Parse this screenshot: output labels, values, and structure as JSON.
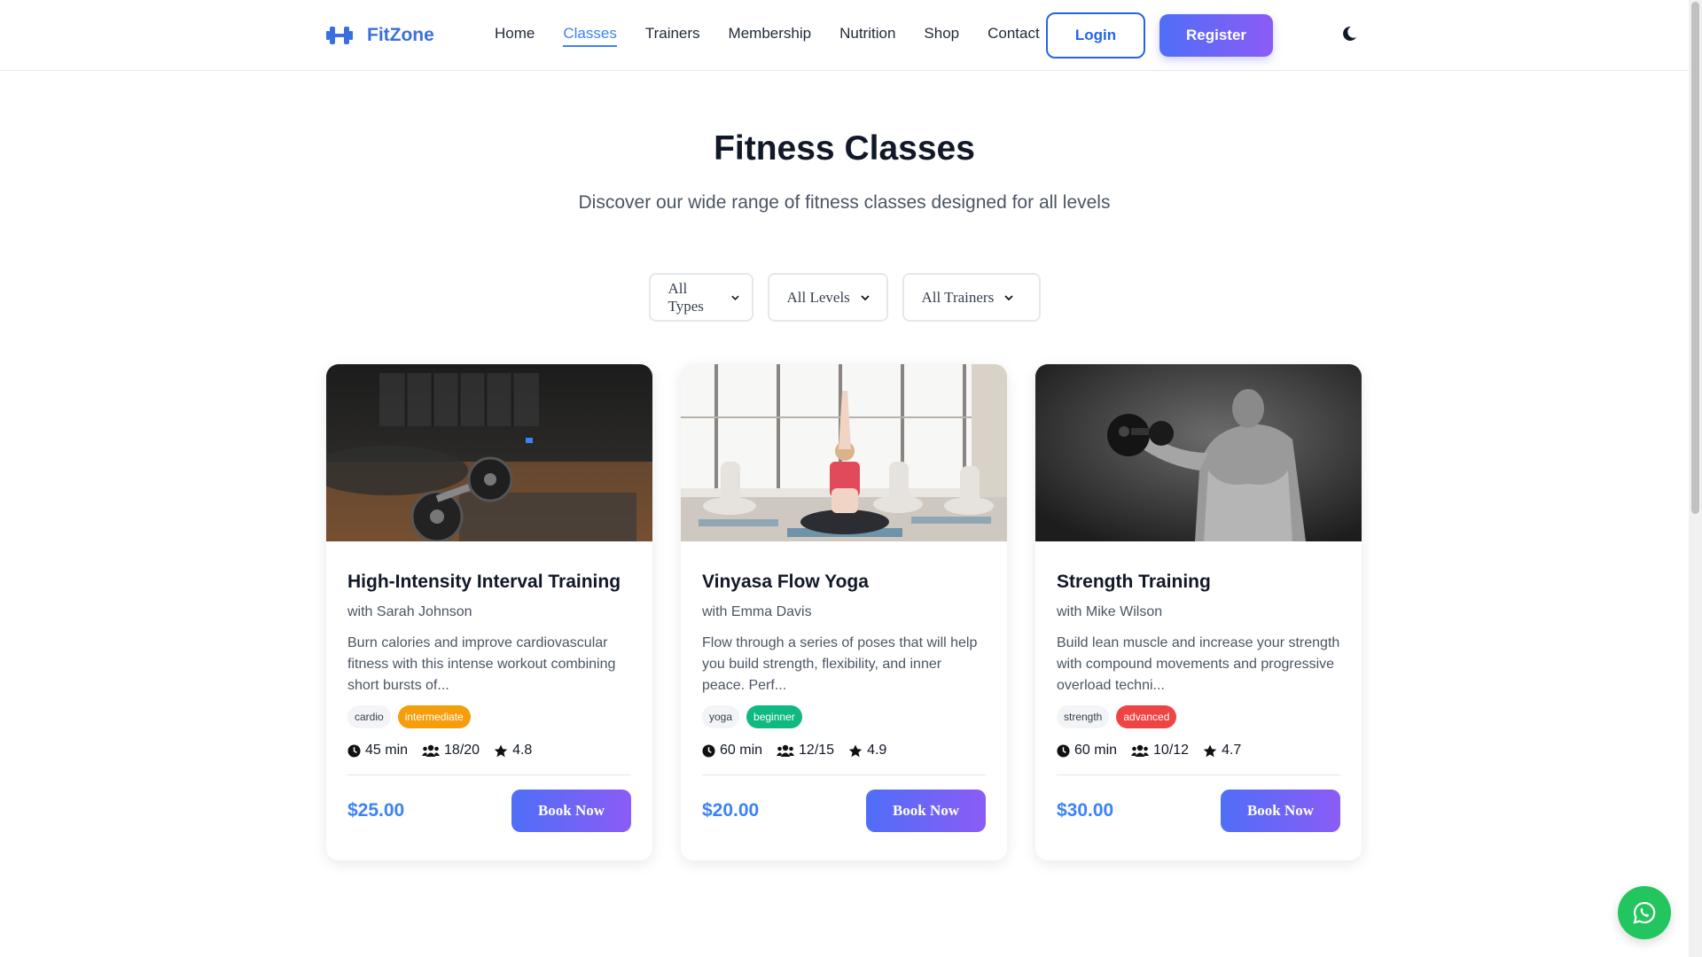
{
  "brand": {
    "name": "FitZone",
    "accent": "#3b6fe0"
  },
  "nav": {
    "items": [
      {
        "label": "Home",
        "active": false
      },
      {
        "label": "Classes",
        "active": true
      },
      {
        "label": "Trainers",
        "active": false
      },
      {
        "label": "Membership",
        "active": false
      },
      {
        "label": "Nutrition",
        "active": false
      },
      {
        "label": "Shop",
        "active": false
      },
      {
        "label": "Contact",
        "active": false
      }
    ],
    "login_label": "Login",
    "register_label": "Register",
    "theme_icon": "moon-icon"
  },
  "hero": {
    "title": "Fitness Classes",
    "subtitle": "Discover our wide range of fitness classes designed for all levels"
  },
  "filters": {
    "type": "All Types",
    "level": "All Levels",
    "trainer": "All Trainers"
  },
  "classes": [
    {
      "title": "High-Intensity Interval Training",
      "trainer": "with Sarah Johnson",
      "description": "Burn calories and improve cardiovascular fitness with this intense workout combining short bursts of...",
      "type_tag": "cardio",
      "level_tag": "intermediate",
      "level_color": "#f59e0b",
      "duration": "45 min",
      "capacity": "18/20",
      "rating": "4.8",
      "price": "$25.00",
      "cta": "Book Now",
      "image": "gym-dumbbell-photo"
    },
    {
      "title": "Vinyasa Flow Yoga",
      "trainer": "with Emma Davis",
      "description": "Flow through a series of poses that will help you build strength, flexibility, and inner peace. Perf...",
      "type_tag": "yoga",
      "level_tag": "beginner",
      "level_color": "#10b981",
      "duration": "60 min",
      "capacity": "12/15",
      "rating": "4.9",
      "price": "$20.00",
      "cta": "Book Now",
      "image": "yoga-class-photo"
    },
    {
      "title": "Strength Training",
      "trainer": "with Mike Wilson",
      "description": "Build lean muscle and increase your strength with compound movements and progressive overload techni...",
      "type_tag": "strength",
      "level_tag": "advanced",
      "level_color": "#ef4444",
      "duration": "60 min",
      "capacity": "10/12",
      "rating": "4.7",
      "price": "$30.00",
      "cta": "Book Now",
      "image": "bodybuilder-photo"
    }
  ],
  "chat_button": {
    "icon": "whatsapp-icon",
    "color": "#22c55e"
  }
}
